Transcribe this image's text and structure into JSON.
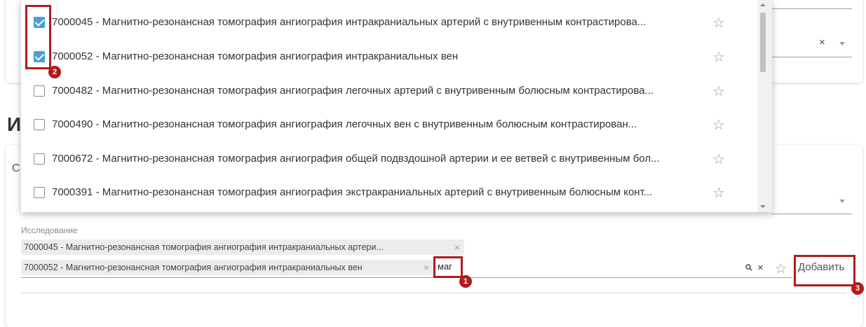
{
  "section": {
    "heading": "И",
    "subheading_letter": "С"
  },
  "dropdown": {
    "items": [
      {
        "text": "7000045 - Магнитно-резонансная томография ангиография интракраниальных артерий с внутривенным контрастирова...",
        "checked": true
      },
      {
        "text": "7000052 - Магнитно-резонансная томография ангиография интракраниальных вен",
        "checked": true
      },
      {
        "text": "7000482 - Магнитно-резонансная томография ангиография легочных артерий с внутривенным болюсным контрастирова...",
        "checked": false
      },
      {
        "text": "7000490 - Магнитно-резонансная томография ангиография легочных вен с внутривенным болюсным контрастирован...",
        "checked": false
      },
      {
        "text": "7000672 - Магнитно-резонансная томография ангиография общей подвздошной артерии и ее ветвей с внутривенным бол...",
        "checked": false
      },
      {
        "text": "7000391 - Магнитно-резонансная томография ангиография экстракраниальных артерий с внутривенным болюсным конт...",
        "checked": false
      }
    ]
  },
  "top_field": {
    "clear_icon": "×"
  },
  "research": {
    "label": "Исследование",
    "chips": [
      {
        "text": "7000045 - Магнитно-резонансная томография ангиография интракраниальных артери..."
      },
      {
        "text": "7000052 - Магнитно-резонансная томография ангиография интракраниальных вен"
      }
    ],
    "chip_remove_icon": "×",
    "input_value": "маг",
    "search_icon": "search-icon",
    "clear_icon": "×",
    "add_button_label": "Добавить"
  },
  "icons": {
    "star": "☆",
    "search": "🔍"
  },
  "markers": {
    "one": "1",
    "two": "2",
    "three": "3"
  },
  "colors": {
    "annotation": "#b01c1c",
    "checkbox_checked": "#4a9fd8"
  }
}
